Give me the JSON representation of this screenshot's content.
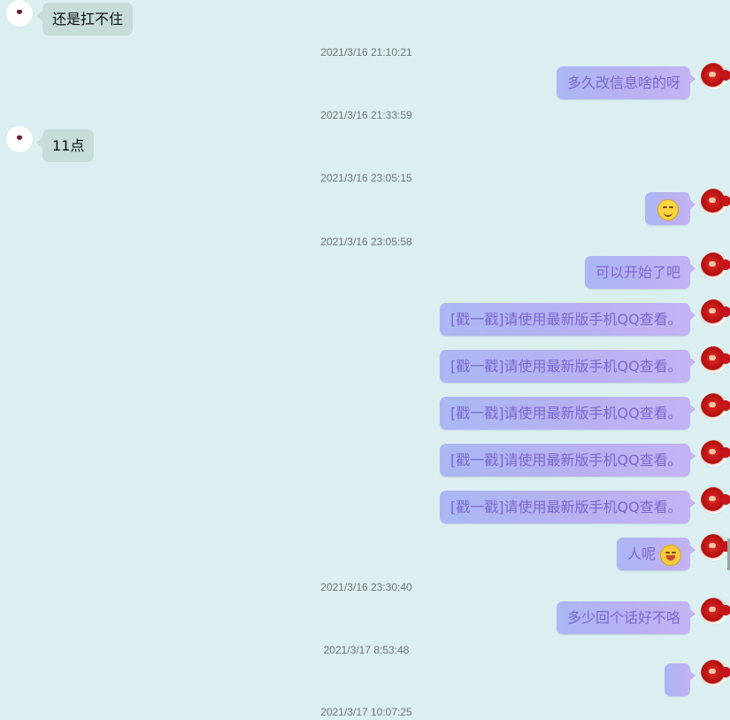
{
  "messages": {
    "m1": "还是扛不住",
    "m2": "多久改信息啥的呀",
    "m3": "11点",
    "m4": "可以开始了吧",
    "m5": "[戳一戳]请使用最新版手机QQ查看。",
    "m6": "[戳一戳]请使用最新版手机QQ查看。",
    "m7": "[戳一戳]请使用最新版手机QQ查看。",
    "m8": "[戳一戳]请使用最新版手机QQ查看。",
    "m9": "[戳一戳]请使用最新版手机QQ查看。",
    "m10": "人呢",
    "m11": "多少回个话好不咯"
  },
  "timestamps": {
    "t1": "2021/3/16 21:10:21",
    "t2": "2021/3/16 21:33:59",
    "t3": "2021/3/16 23:05:15",
    "t4": "2021/3/16 23:05:58",
    "t5": "2021/3/16 23:30:40",
    "t6": "2021/3/17 8:53:48",
    "t7": "2021/3/17 10:07:25"
  },
  "icons": {
    "smile": "smile-emoji-icon",
    "laugh": "laughing-emoji-icon"
  },
  "colors": {
    "background": "#dbeff0",
    "received_bubble": "#c5dcd9",
    "sent_bubble": "#b8b0f2",
    "sent_text": "#7c68cf"
  }
}
